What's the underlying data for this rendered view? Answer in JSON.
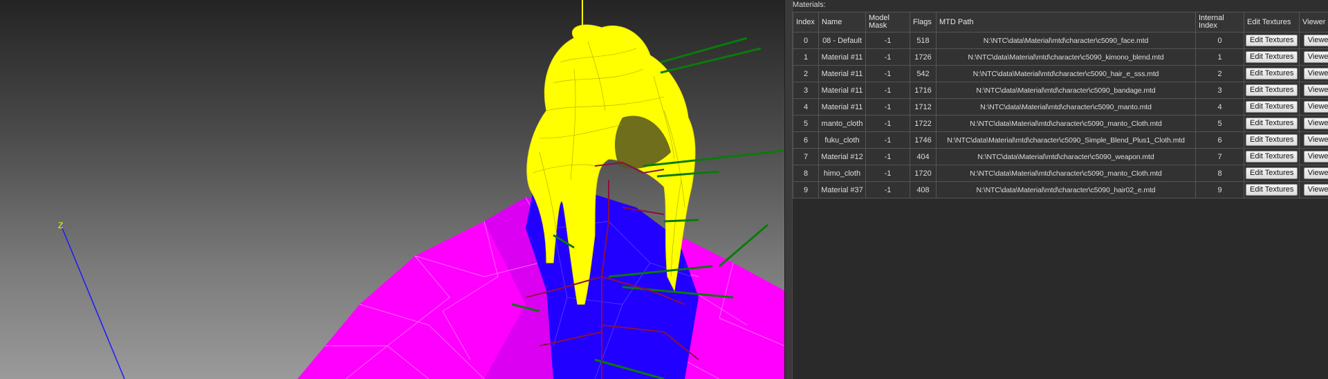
{
  "viewport": {
    "axis_label": "Z"
  },
  "panel": {
    "label": "Materials:"
  },
  "table": {
    "columns": [
      "Index",
      "Name",
      "Model Mask",
      "Flags",
      "MTD Path",
      "Internal Index",
      "Edit Textures",
      "Viewer H"
    ],
    "rows": [
      {
        "index": "0",
        "name": "08 - Default",
        "mask": "-1",
        "flags": "518",
        "path": "N:\\NTC\\data\\Material\\mtd\\character\\c5090_face.mtd",
        "internal": "0",
        "edit": "Edit Textures",
        "viewer": "Viewer"
      },
      {
        "index": "1",
        "name": "Material #11",
        "mask": "-1",
        "flags": "1726",
        "path": "N:\\NTC\\data\\Material\\mtd\\character\\c5090_kimono_blend.mtd",
        "internal": "1",
        "edit": "Edit Textures",
        "viewer": "Viewer"
      },
      {
        "index": "2",
        "name": "Material #11",
        "mask": "-1",
        "flags": "542",
        "path": "N:\\NTC\\data\\Material\\mtd\\character\\c5090_hair_e_sss.mtd",
        "internal": "2",
        "edit": "Edit Textures",
        "viewer": "Viewer"
      },
      {
        "index": "3",
        "name": "Material #11",
        "mask": "-1",
        "flags": "1716",
        "path": "N:\\NTC\\data\\Material\\mtd\\character\\c5090_bandage.mtd",
        "internal": "3",
        "edit": "Edit Textures",
        "viewer": "Viewer"
      },
      {
        "index": "4",
        "name": "Material #11",
        "mask": "-1",
        "flags": "1712",
        "path": "N:\\NTC\\data\\Material\\mtd\\character\\c5090_manto.mtd",
        "internal": "4",
        "edit": "Edit Textures",
        "viewer": "Viewer"
      },
      {
        "index": "5",
        "name": "manto_cloth",
        "mask": "-1",
        "flags": "1722",
        "path": "N:\\NTC\\data\\Material\\mtd\\character\\c5090_manto_Cloth.mtd",
        "internal": "5",
        "edit": "Edit Textures",
        "viewer": "Viewer"
      },
      {
        "index": "6",
        "name": "fuku_cloth",
        "mask": "-1",
        "flags": "1746",
        "path": "N:\\NTC\\data\\Material\\mtd\\character\\c5090_Simple_Blend_Plus1_Cloth.mtd",
        "internal": "6",
        "edit": "Edit Textures",
        "viewer": "Viewer"
      },
      {
        "index": "7",
        "name": "Material #12",
        "mask": "-1",
        "flags": "404",
        "path": "N:\\NTC\\data\\Material\\mtd\\character\\c5090_weapon.mtd",
        "internal": "7",
        "edit": "Edit Textures",
        "viewer": "Viewer"
      },
      {
        "index": "8",
        "name": "himo_cloth",
        "mask": "-1",
        "flags": "1720",
        "path": "N:\\NTC\\data\\Material\\mtd\\character\\c5090_manto_Cloth.mtd",
        "internal": "8",
        "edit": "Edit Textures",
        "viewer": "Viewer"
      },
      {
        "index": "9",
        "name": "Material #37",
        "mask": "-1",
        "flags": "408",
        "path": "N:\\NTC\\data\\Material\\mtd\\character\\c5090_hair02_e.mtd",
        "internal": "9",
        "edit": "Edit Textures",
        "viewer": "Viewer"
      }
    ]
  },
  "colors": {
    "viewport_top": "#242424",
    "viewport_bottom": "#9a9a9a",
    "mesh_hair": "#ffff00",
    "mesh_cloak": "#ff00ff",
    "mesh_body": "#2200ff",
    "bones": "#0a7a0a",
    "panel_bg": "#2f2f2f",
    "grid_line": "#555555"
  }
}
